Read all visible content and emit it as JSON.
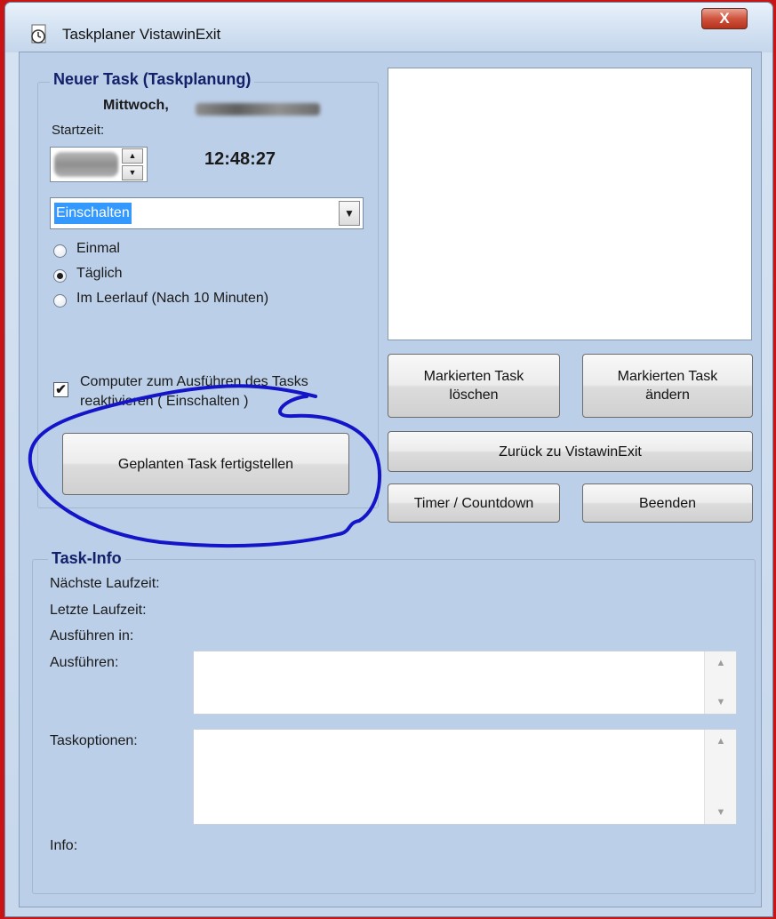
{
  "window": {
    "title": "Taskplaner VistawinExit",
    "close_label": "X"
  },
  "new_task": {
    "legend": "Neuer Task  (Taskplanung)",
    "day_label": "Mittwoch,",
    "start_label": "Startzeit:",
    "clock": "12:48:27",
    "action_combo_value": "Einschalten",
    "radios": [
      {
        "label": "Einmal",
        "checked": false
      },
      {
        "label": "Täglich",
        "checked": true
      },
      {
        "label": "Im Leerlauf (Nach 10 Minuten)",
        "checked": false
      }
    ],
    "wake_checkbox_label_1": "Computer zum Ausführen des Tasks",
    "wake_checkbox_label_2": "reaktivieren ( Einschalten )",
    "wake_checked": true,
    "finish_button": "Geplanten Task fertigstellen"
  },
  "actions": {
    "delete_line1": "Markierten Task",
    "delete_line2": "löschen",
    "edit_line1": "Markierten Task",
    "edit_line2": "ändern",
    "back_button": "Zurück zu VistawinExit",
    "timer_button": "Timer / Countdown",
    "quit_button": "Beenden"
  },
  "task_info": {
    "legend": "Task-Info",
    "next_run": "Nächste Laufzeit:",
    "last_run": "Letzte Laufzeit:",
    "run_in": "Ausführen in:",
    "execute": "Ausführen:",
    "options": "Taskoptionen:",
    "info": "Info:"
  },
  "colors": {
    "annotation": "#1414c8",
    "selection": "#3399ff",
    "legend_text": "#14206a"
  }
}
